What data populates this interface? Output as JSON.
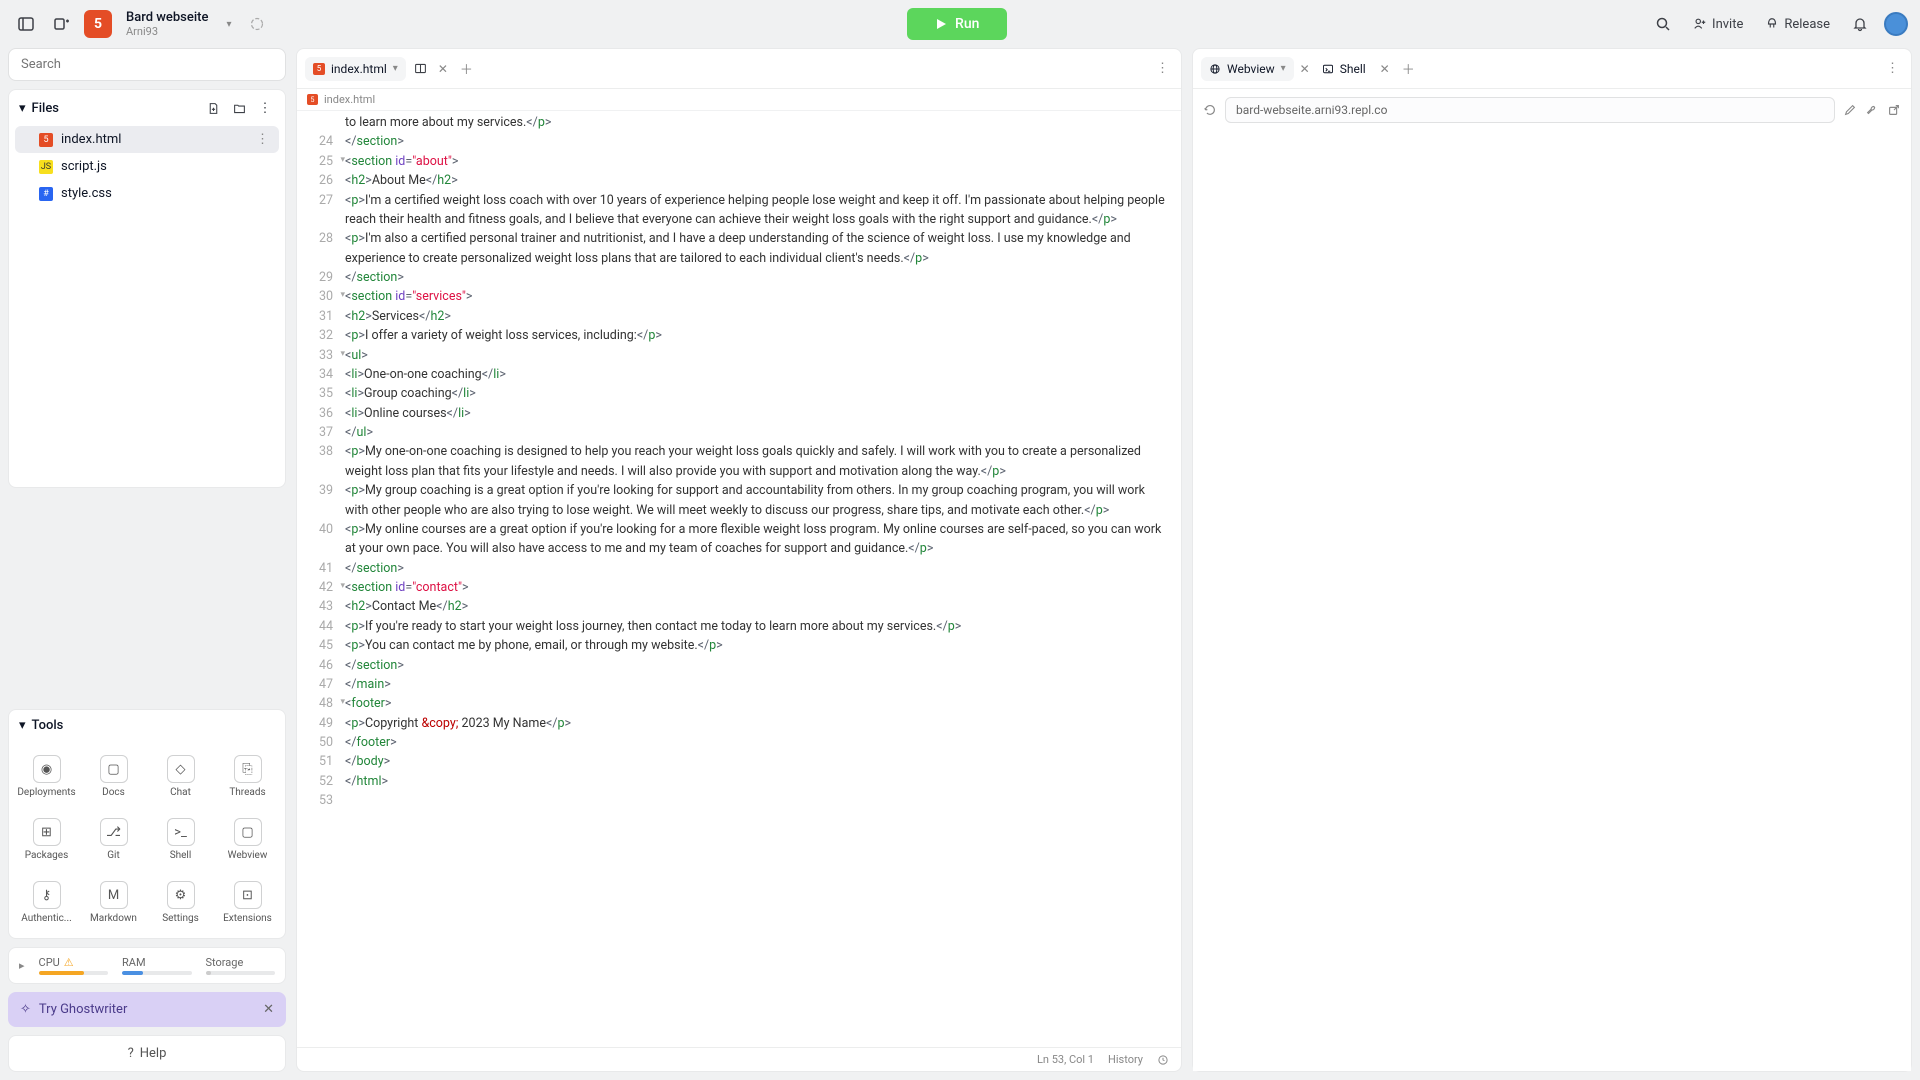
{
  "header": {
    "project_name": "Bard webseite",
    "owner": "Arni93",
    "run_label": "Run",
    "invite_label": "Invite",
    "release_label": "Release"
  },
  "search": {
    "placeholder": "Search"
  },
  "files": {
    "title": "Files",
    "items": [
      {
        "name": "index.html",
        "type": "html",
        "active": true
      },
      {
        "name": "script.js",
        "type": "js",
        "active": false
      },
      {
        "name": "style.css",
        "type": "css",
        "active": false
      }
    ]
  },
  "tools": {
    "title": "Tools",
    "items": [
      {
        "label": "Deployments"
      },
      {
        "label": "Docs"
      },
      {
        "label": "Chat"
      },
      {
        "label": "Threads"
      },
      {
        "label": "Packages"
      },
      {
        "label": "Git"
      },
      {
        "label": "Shell"
      },
      {
        "label": "Webview"
      },
      {
        "label": "Authentic..."
      },
      {
        "label": "Markdown"
      },
      {
        "label": "Settings"
      },
      {
        "label": "Extensions"
      }
    ]
  },
  "resources": {
    "cpu": {
      "label": "CPU",
      "pct": 65,
      "color": "#f5a623",
      "warn": true
    },
    "ram": {
      "label": "RAM",
      "pct": 30,
      "color": "#4a90e2"
    },
    "storage": {
      "label": "Storage",
      "pct": 8,
      "color": "#ccc"
    }
  },
  "ghostwriter": {
    "label": "Try Ghostwriter"
  },
  "help": {
    "label": "Help"
  },
  "editor": {
    "tab_name": "index.html",
    "crumb": "index.html",
    "status_pos": "Ln 53, Col 1",
    "status_history": "History",
    "lines": [
      {
        "n": 24,
        "tokens": [
          [
            "</",
            "b"
          ],
          [
            "section",
            "t"
          ],
          [
            ">",
            "b"
          ]
        ]
      },
      {
        "n": 25,
        "fold": true,
        "tokens": [
          [
            "<",
            "b"
          ],
          [
            "section",
            "t"
          ],
          [
            " ",
            "x"
          ],
          [
            "id",
            "a"
          ],
          [
            "=",
            "b"
          ],
          [
            "\"about\"",
            "s"
          ],
          [
            ">",
            "b"
          ]
        ]
      },
      {
        "n": 26,
        "tokens": [
          [
            "<",
            "b"
          ],
          [
            "h2",
            "t"
          ],
          [
            ">",
            "b"
          ],
          [
            "About Me",
            "x"
          ],
          [
            "</",
            "b"
          ],
          [
            "h2",
            "t"
          ],
          [
            ">",
            "b"
          ]
        ]
      },
      {
        "n": 27,
        "tokens": [
          [
            "<",
            "b"
          ],
          [
            "p",
            "t"
          ],
          [
            ">",
            "b"
          ],
          [
            "I'm a certified weight loss coach with over 10 years of experience helping people lose weight and keep it off. I'm passionate about helping people reach their health and fitness goals, and I believe that everyone can achieve their weight loss goals with the right support and guidance.",
            "x"
          ],
          [
            "</",
            "b"
          ],
          [
            "p",
            "t"
          ],
          [
            ">",
            "b"
          ]
        ]
      },
      {
        "n": 28,
        "tokens": [
          [
            "<",
            "b"
          ],
          [
            "p",
            "t"
          ],
          [
            ">",
            "b"
          ],
          [
            "I'm also a certified personal trainer and nutritionist, and I have a deep understanding of the science of weight loss. I use my knowledge and experience to create personalized weight loss plans that are tailored to each individual client's needs.",
            "x"
          ],
          [
            "</",
            "b"
          ],
          [
            "p",
            "t"
          ],
          [
            ">",
            "b"
          ]
        ]
      },
      {
        "n": 29,
        "tokens": [
          [
            "</",
            "b"
          ],
          [
            "section",
            "t"
          ],
          [
            ">",
            "b"
          ]
        ]
      },
      {
        "n": 30,
        "fold": true,
        "tokens": [
          [
            "<",
            "b"
          ],
          [
            "section",
            "t"
          ],
          [
            " ",
            "x"
          ],
          [
            "id",
            "a"
          ],
          [
            "=",
            "b"
          ],
          [
            "\"services\"",
            "s"
          ],
          [
            ">",
            "b"
          ]
        ]
      },
      {
        "n": 31,
        "tokens": [
          [
            "<",
            "b"
          ],
          [
            "h2",
            "t"
          ],
          [
            ">",
            "b"
          ],
          [
            "Services",
            "x"
          ],
          [
            "</",
            "b"
          ],
          [
            "h2",
            "t"
          ],
          [
            ">",
            "b"
          ]
        ]
      },
      {
        "n": 32,
        "tokens": [
          [
            "<",
            "b"
          ],
          [
            "p",
            "t"
          ],
          [
            ">",
            "b"
          ],
          [
            "I offer a variety of weight loss services, including:",
            "x"
          ],
          [
            "</",
            "b"
          ],
          [
            "p",
            "t"
          ],
          [
            ">",
            "b"
          ]
        ]
      },
      {
        "n": 33,
        "fold": true,
        "tokens": [
          [
            "<",
            "b"
          ],
          [
            "ul",
            "t"
          ],
          [
            ">",
            "b"
          ]
        ]
      },
      {
        "n": 34,
        "tokens": [
          [
            "<",
            "b"
          ],
          [
            "li",
            "t"
          ],
          [
            ">",
            "b"
          ],
          [
            "One-on-one coaching",
            "x"
          ],
          [
            "</",
            "b"
          ],
          [
            "li",
            "t"
          ],
          [
            ">",
            "b"
          ]
        ]
      },
      {
        "n": 35,
        "tokens": [
          [
            "<",
            "b"
          ],
          [
            "li",
            "t"
          ],
          [
            ">",
            "b"
          ],
          [
            "Group coaching",
            "x"
          ],
          [
            "</",
            "b"
          ],
          [
            "li",
            "t"
          ],
          [
            ">",
            "b"
          ]
        ]
      },
      {
        "n": 36,
        "tokens": [
          [
            "<",
            "b"
          ],
          [
            "li",
            "t"
          ],
          [
            ">",
            "b"
          ],
          [
            "Online courses",
            "x"
          ],
          [
            "</",
            "b"
          ],
          [
            "li",
            "t"
          ],
          [
            ">",
            "b"
          ]
        ]
      },
      {
        "n": 37,
        "tokens": [
          [
            "</",
            "b"
          ],
          [
            "ul",
            "t"
          ],
          [
            ">",
            "b"
          ]
        ]
      },
      {
        "n": 38,
        "tokens": [
          [
            "<",
            "b"
          ],
          [
            "p",
            "t"
          ],
          [
            ">",
            "b"
          ],
          [
            "My one-on-one coaching is designed to help you reach your weight loss goals quickly and safely. I will work with you to create a personalized weight loss plan that fits your lifestyle and needs. I will also provide you with support and motivation along the way.",
            "x"
          ],
          [
            "</",
            "b"
          ],
          [
            "p",
            "t"
          ],
          [
            ">",
            "b"
          ]
        ]
      },
      {
        "n": 39,
        "tokens": [
          [
            "<",
            "b"
          ],
          [
            "p",
            "t"
          ],
          [
            ">",
            "b"
          ],
          [
            "My group coaching is a great option if you're looking for support and accountability from others. In my group coaching program, you will work with other people who are also trying to lose weight. We will meet weekly to discuss our progress, share tips, and motivate each other.",
            "x"
          ],
          [
            "</",
            "b"
          ],
          [
            "p",
            "t"
          ],
          [
            ">",
            "b"
          ]
        ]
      },
      {
        "n": 40,
        "tokens": [
          [
            "<",
            "b"
          ],
          [
            "p",
            "t"
          ],
          [
            ">",
            "b"
          ],
          [
            "My online courses are a great option if you're looking for a more flexible weight loss program. My online courses are self-paced, so you can work at your own pace. You will also have access to me and my team of coaches for support and guidance.",
            "x"
          ],
          [
            "</",
            "b"
          ],
          [
            "p",
            "t"
          ],
          [
            ">",
            "b"
          ]
        ]
      },
      {
        "n": 41,
        "tokens": [
          [
            "</",
            "b"
          ],
          [
            "section",
            "t"
          ],
          [
            ">",
            "b"
          ]
        ]
      },
      {
        "n": 42,
        "fold": true,
        "tokens": [
          [
            "<",
            "b"
          ],
          [
            "section",
            "t"
          ],
          [
            " ",
            "x"
          ],
          [
            "id",
            "a"
          ],
          [
            "=",
            "b"
          ],
          [
            "\"contact\"",
            "s"
          ],
          [
            ">",
            "b"
          ]
        ]
      },
      {
        "n": 43,
        "tokens": [
          [
            "<",
            "b"
          ],
          [
            "h2",
            "t"
          ],
          [
            ">",
            "b"
          ],
          [
            "Contact Me",
            "x"
          ],
          [
            "</",
            "b"
          ],
          [
            "h2",
            "t"
          ],
          [
            ">",
            "b"
          ]
        ]
      },
      {
        "n": 44,
        "tokens": [
          [
            "<",
            "b"
          ],
          [
            "p",
            "t"
          ],
          [
            ">",
            "b"
          ],
          [
            "If you're ready to start your weight loss journey, then contact me today to learn more about my services.",
            "x"
          ],
          [
            "</",
            "b"
          ],
          [
            "p",
            "t"
          ],
          [
            ">",
            "b"
          ]
        ]
      },
      {
        "n": 45,
        "tokens": [
          [
            "<",
            "b"
          ],
          [
            "p",
            "t"
          ],
          [
            ">",
            "b"
          ],
          [
            "You can contact me by phone, email, or through my website.",
            "x"
          ],
          [
            "</",
            "b"
          ],
          [
            "p",
            "t"
          ],
          [
            ">",
            "b"
          ]
        ]
      },
      {
        "n": 46,
        "tokens": [
          [
            "</",
            "b"
          ],
          [
            "section",
            "t"
          ],
          [
            ">",
            "b"
          ]
        ]
      },
      {
        "n": 47,
        "tokens": [
          [
            "</",
            "b"
          ],
          [
            "main",
            "t"
          ],
          [
            ">",
            "b"
          ]
        ]
      },
      {
        "n": 48,
        "fold": true,
        "tokens": [
          [
            "<",
            "b"
          ],
          [
            "footer",
            "t"
          ],
          [
            ">",
            "b"
          ]
        ]
      },
      {
        "n": 49,
        "tokens": [
          [
            "<",
            "b"
          ],
          [
            "p",
            "t"
          ],
          [
            ">",
            "b"
          ],
          [
            "Copyright ",
            "x"
          ],
          [
            "&copy;",
            "e"
          ],
          [
            " 2023 My Name",
            "x"
          ],
          [
            "</",
            "b"
          ],
          [
            "p",
            "t"
          ],
          [
            ">",
            "b"
          ]
        ]
      },
      {
        "n": 50,
        "tokens": [
          [
            "</",
            "b"
          ],
          [
            "footer",
            "t"
          ],
          [
            ">",
            "b"
          ]
        ]
      },
      {
        "n": 51,
        "tokens": [
          [
            "</",
            "b"
          ],
          [
            "body",
            "t"
          ],
          [
            ">",
            "b"
          ]
        ]
      },
      {
        "n": 52,
        "tokens": [
          [
            "</",
            "b"
          ],
          [
            "html",
            "t"
          ],
          [
            ">",
            "b"
          ]
        ]
      },
      {
        "n": 53,
        "tokens": []
      }
    ],
    "partial_top": {
      "text": "to learn more about my services.",
      "close_tag": "p"
    }
  },
  "webview": {
    "tab1": "Webview",
    "tab2": "Shell",
    "url": "bard-webseite.arni93.repl.co"
  }
}
